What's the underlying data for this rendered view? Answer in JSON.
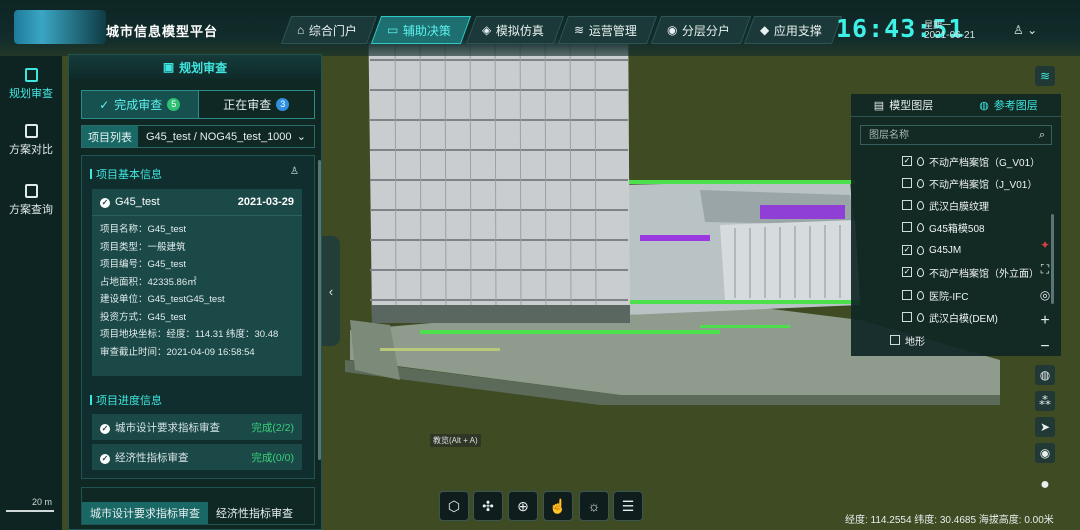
{
  "header": {
    "app_title": "城市信息模型平台",
    "nav": [
      "综合门户",
      "辅助决策",
      "模拟仿真",
      "运营管理",
      "分层分户",
      "应用支撑"
    ],
    "nav_icons": [
      "home-icon",
      "monitor-icon",
      "cube-icon",
      "layers-icon",
      "location-icon",
      "diamond-icon"
    ],
    "clock": "16:43:51",
    "weekday": "星期一",
    "date": "2021-06-21"
  },
  "rail": {
    "items": [
      "规划审查",
      "方案对比",
      "方案查询"
    ]
  },
  "panel": {
    "title": "规划审查",
    "tabs": [
      {
        "label": "完成审查",
        "count": "5"
      },
      {
        "label": "正在审查",
        "count": "3"
      }
    ],
    "select": {
      "label": "项目列表",
      "value": "G45_test / NOG45_test_1000"
    },
    "basic_info_title": "项目基本信息",
    "card": {
      "name": "G45_test",
      "date": "2021-03-29",
      "rows": [
        "项目名称：G45_test",
        "项目类型：一般建筑",
        "项目编号：G45_test",
        "占地面积：42335.86㎡",
        "建设单位：G45_testG45_test",
        "投资方式：G45_test",
        "项目地块坐标：经度：114.31  纬度：30.48",
        "审查截止时间：2021-04-09 16:58:54"
      ]
    },
    "progress_title": "项目进度信息",
    "progress": [
      {
        "label": "城市设计要求指标审查",
        "status": "完成(2/2)"
      },
      {
        "label": "经济性指标审查",
        "status": "完成(0/0)"
      }
    ],
    "bottom_tabs": [
      "城市设计要求指标审查",
      "经济性指标审查"
    ]
  },
  "scene": {
    "scale": "20 m",
    "hint": "教览(Alt + A)"
  },
  "layers": {
    "tabs": [
      "模型图层",
      "参考图层"
    ],
    "search_placeholder": "图层名称",
    "items": [
      {
        "label": "不动产档案馆（G_V01）",
        "checked": true
      },
      {
        "label": "不动产档案馆（J_V01）",
        "checked": false
      },
      {
        "label": "武汉白膜纹理",
        "checked": false
      },
      {
        "label": "G45箱模508",
        "checked": false
      },
      {
        "label": "G45JM",
        "checked": true
      },
      {
        "label": "不动产档案馆（外立面）",
        "checked": true
      },
      {
        "label": "医院-IFC",
        "checked": false
      },
      {
        "label": "武汉白模(DEM)",
        "checked": false
      }
    ],
    "terrain": "地形"
  },
  "status": {
    "text": "经度: 114.2554  纬度: 30.4685  海拔高度: 0.00米"
  },
  "colors": {
    "accent": "#3fe6e0",
    "active_tab_bg": "#16514f",
    "done": "#37d07a",
    "badge_done": "#2fbf71",
    "badge_active": "#2f8fe0"
  }
}
